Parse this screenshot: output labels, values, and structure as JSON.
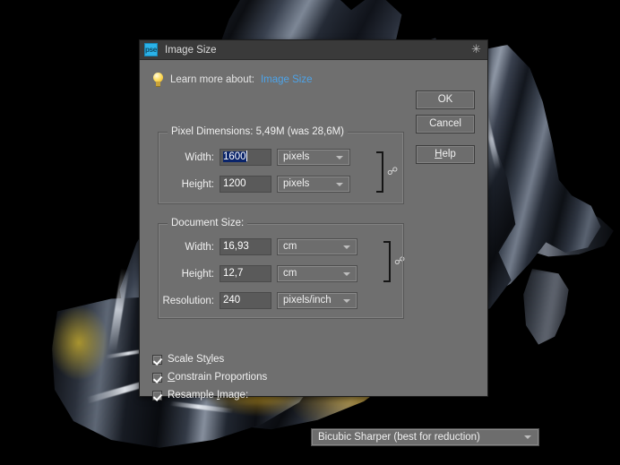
{
  "window": {
    "title": "Image Size",
    "app_icon": "pse",
    "close_icon": "✳",
    "accent_link_color": "#4da3e8",
    "selection_color": "#0a246a"
  },
  "learn_more": {
    "bulb_icon": "lightbulb-icon",
    "prefix": "Learn more about:",
    "link": "Image Size"
  },
  "buttons": {
    "ok": "OK",
    "cancel": "Cancel",
    "help_accel": "H",
    "help_rest": "elp"
  },
  "pixel_dimensions": {
    "title": "Pixel Dimensions:  5,49M (was 28,6M)",
    "width": {
      "label": "Width:",
      "value": "1600",
      "unit": "pixels"
    },
    "height": {
      "label": "Height:",
      "value": "1200",
      "unit": "pixels"
    },
    "link_icon": "chain-link-icon"
  },
  "document_size": {
    "title": "Document Size:",
    "width": {
      "label": "Width:",
      "value": "16,93",
      "unit": "cm"
    },
    "height": {
      "label": "Height:",
      "value": "12,7",
      "unit": "cm"
    },
    "resolution": {
      "label": "Resolution:",
      "value": "240",
      "unit": "pixels/inch"
    },
    "link_icon": "chain-link-icon"
  },
  "options": {
    "scale_styles": {
      "pre": "Scale St",
      "accel": "y",
      "post": "les",
      "checked": true
    },
    "constrain_proportions": {
      "pre": "",
      "accel": "C",
      "post": "onstrain Proportions",
      "checked": true
    },
    "resample_image": {
      "pre": "Resample ",
      "accel": "I",
      "post": "mage:",
      "checked": true
    },
    "resample_method": "Bicubic Sharper (best for reduction)"
  }
}
